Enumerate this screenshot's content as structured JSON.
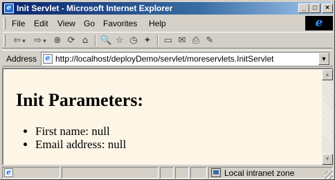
{
  "window": {
    "title": "Init Servlet - Microsoft Internet Explorer",
    "app_icon": "ie-page-icon",
    "controls": {
      "minimize": "_",
      "maximize": "□",
      "close": "×"
    }
  },
  "menubar": {
    "items": [
      {
        "label": "File"
      },
      {
        "label": "Edit"
      },
      {
        "label": "View"
      },
      {
        "label": "Go"
      },
      {
        "label": "Favorites"
      },
      {
        "label": "Help"
      }
    ],
    "logo": "e"
  },
  "toolbar": {
    "icons": {
      "back": "⇦",
      "forward": "⇨",
      "stop": "⊗",
      "refresh": "⟳",
      "home": "⌂",
      "search": "🔍",
      "favorites": "☆",
      "history": "◷",
      "channels": "✦",
      "fullscreen": "▭",
      "mail": "✉",
      "print": "⎙",
      "edit": "✎"
    }
  },
  "addressbar": {
    "label": "Address",
    "url": "http://localhost/deployDemo/servlet/moreservlets.InitServlet",
    "page_icon": "e"
  },
  "page": {
    "heading": "Init Parameters:",
    "items": [
      {
        "text": "First name: null"
      },
      {
        "text": "Email address: null"
      }
    ],
    "background": "#fdf5e6"
  },
  "statusbar": {
    "page_icon": "e",
    "zone": "Local intranet zone"
  }
}
